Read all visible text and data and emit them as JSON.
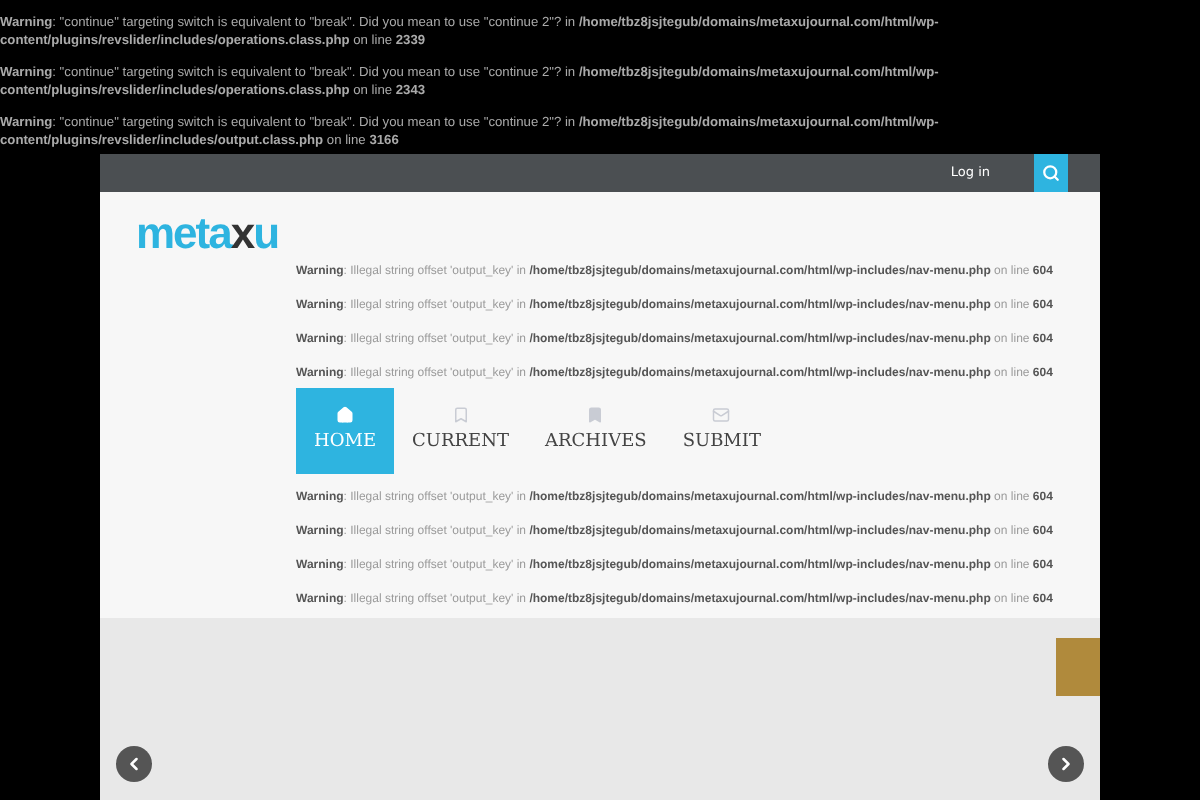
{
  "top_warnings": [
    "**Warning**: \"continue\" targeting switch is equivalent to \"break\". Did you mean to use \"continue 2\"? in **/home/tbz8jsjtegub/domains/metaxujournal.com/html/wp-content/plugins/revslider/includes/operations.class.php** on line **2339**",
    "**Warning**: \"continue\" targeting switch is equivalent to \"break\". Did you mean to use \"continue 2\"? in **/home/tbz8jsjtegub/domains/metaxujournal.com/html/wp-content/plugins/revslider/includes/operations.class.php** on line **2343**",
    "**Warning**: \"continue\" targeting switch is equivalent to \"break\". Did you mean to use \"continue 2\"? in **/home/tbz8jsjtegub/domains/metaxujournal.com/html/wp-content/plugins/revslider/includes/output.class.php** on line **3166**"
  ],
  "top_bar": {
    "login": "Log in"
  },
  "logo": [
    {
      "text": "meta",
      "dark": false
    },
    {
      "text": "x",
      "dark": true
    },
    {
      "text": "u",
      "dark": false
    }
  ],
  "warnings_before_nav": [
    "**Warning**: Illegal string offset 'output_key' in **/home/tbz8jsjtegub/domains/metaxujournal.com/html/wp-includes/nav-menu.php** on line **604**",
    "**Warning**: Illegal string offset 'output_key' in **/home/tbz8jsjtegub/domains/metaxujournal.com/html/wp-includes/nav-menu.php** on line **604**",
    "**Warning**: Illegal string offset 'output_key' in **/home/tbz8jsjtegub/domains/metaxujournal.com/html/wp-includes/nav-menu.php** on line **604**",
    "**Warning**: Illegal string offset 'output_key' in **/home/tbz8jsjtegub/domains/metaxujournal.com/html/wp-includes/nav-menu.php** on line **604**"
  ],
  "nav": [
    {
      "label": "HOME",
      "kind": "home",
      "selected": true
    },
    {
      "label": "CURRENT",
      "kind": "bookmark",
      "selected": false
    },
    {
      "label": "ARCHIVES",
      "kind": "saved",
      "selected": false
    },
    {
      "label": "SUBMIT",
      "kind": "mail",
      "selected": false
    }
  ],
  "warnings_after_nav": [
    "**Warning**: Illegal string offset 'output_key' in **/home/tbz8jsjtegub/domains/metaxujournal.com/html/wp-includes/nav-menu.php** on line **604**",
    "**Warning**: Illegal string offset 'output_key' in **/home/tbz8jsjtegub/domains/metaxujournal.com/html/wp-includes/nav-menu.php** on line **604**",
    "**Warning**: Illegal string offset 'output_key' in **/home/tbz8jsjtegub/domains/metaxujournal.com/html/wp-includes/nav-menu.php** on line **604**",
    "**Warning**: Illegal string offset 'output_key' in **/home/tbz8jsjtegub/domains/metaxujournal.com/html/wp-includes/nav-menu.php** on line **604**"
  ]
}
